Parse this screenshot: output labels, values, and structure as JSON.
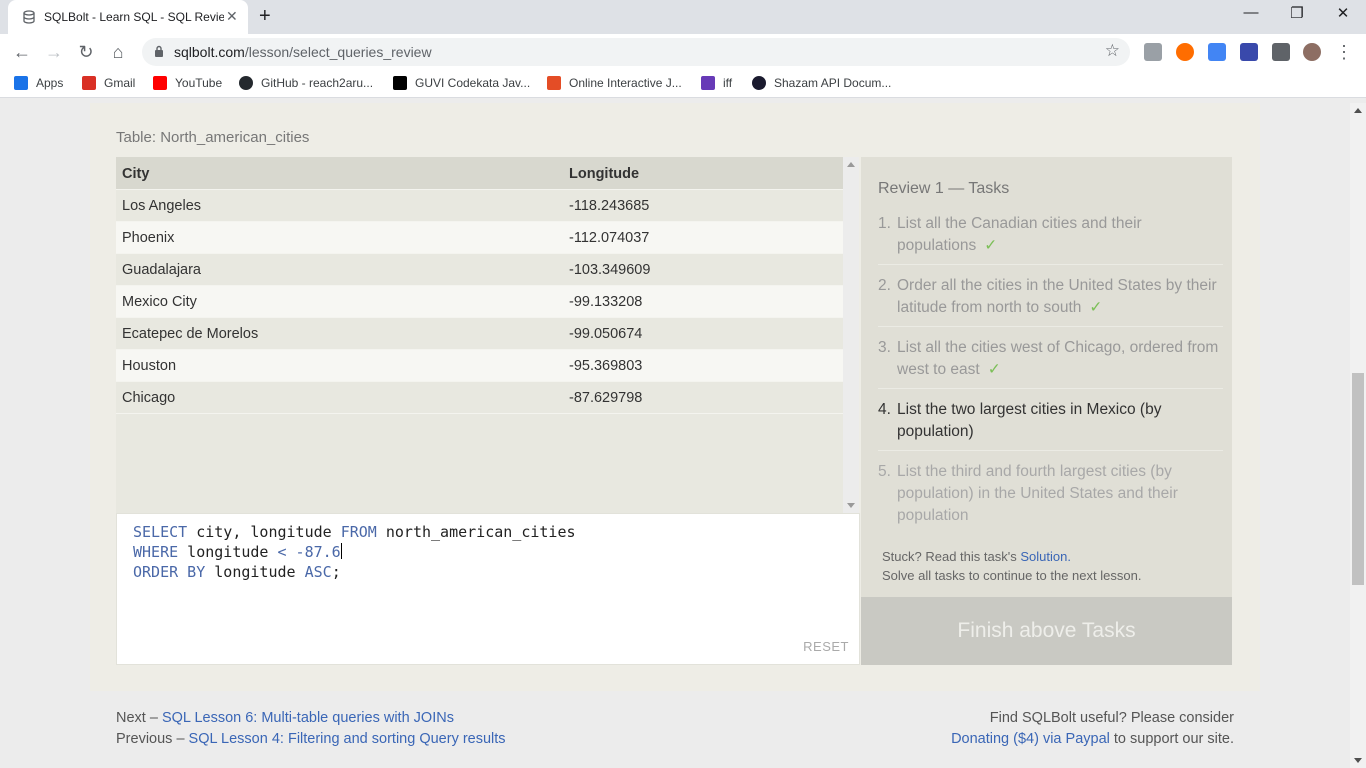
{
  "browser": {
    "tab_title": "SQLBolt - Learn SQL - SQL Review",
    "new_tab": "+",
    "url_host": "sqlbolt.com",
    "url_path": "/lesson/select_queries_review",
    "window_controls": {
      "minimize": "—",
      "restore": "❐",
      "close": "✕"
    },
    "nav": {
      "back": "←",
      "forward": "→",
      "reload": "↻",
      "home": "⌂"
    },
    "bookmarks": [
      {
        "label": "Apps",
        "icon": "apps-grid-icon",
        "color": "#1a73e8"
      },
      {
        "label": "Gmail",
        "icon": "gmail-icon",
        "color": "#d93025"
      },
      {
        "label": "YouTube",
        "icon": "youtube-icon",
        "color": "#ff0000"
      },
      {
        "label": "GitHub - reach2aru...",
        "icon": "github-icon",
        "color": "#24292e"
      },
      {
        "label": "GUVI Codekata Jav...",
        "icon": "medium-icon",
        "color": "#000000"
      },
      {
        "label": "Online Interactive J...",
        "icon": "html5-icon",
        "color": "#e44d26"
      },
      {
        "label": "iff",
        "icon": "list-icon",
        "color": "#673ab7"
      },
      {
        "label": "Shazam API Docum...",
        "icon": "shazam-icon",
        "color": "#1a1a2e"
      }
    ]
  },
  "page": {
    "table_caption": "Table: North_american_cities",
    "columns": [
      "City",
      "Longitude"
    ],
    "rows": [
      [
        "Los Angeles",
        "-118.243685"
      ],
      [
        "Phoenix",
        "-112.074037"
      ],
      [
        "Guadalajara",
        "-103.349609"
      ],
      [
        "Mexico City",
        "-99.133208"
      ],
      [
        "Ecatepec de Morelos",
        "-99.050674"
      ],
      [
        "Houston",
        "-95.369803"
      ],
      [
        "Chicago",
        "-87.629798"
      ]
    ],
    "query": {
      "line1_kw1": "SELECT",
      "line1_text1": " city, longitude ",
      "line1_kw2": "FROM",
      "line1_text2": " north_american_cities",
      "line2_kw1": "WHERE",
      "line2_text1": " longitude ",
      "line2_op": "<",
      "line2_num": " -87.6",
      "line3_kw1": "ORDER BY",
      "line3_text1": " longitude ",
      "line3_kw2": "ASC",
      "line3_end": ";"
    },
    "reset_label": "RESET",
    "tasks_title": "Review 1 — Tasks",
    "tasks": [
      {
        "num": "1.",
        "text": "List all the Canadian cities and their populations",
        "done": "✓"
      },
      {
        "num": "2.",
        "text": "Order all the cities in the United States by their latitude from north to south",
        "done": "✓"
      },
      {
        "num": "3.",
        "text": "List all the cities west of Chicago, ordered from west to east",
        "done": "✓"
      },
      {
        "num": "4.",
        "text": "List the two largest cities in Mexico (by population)"
      },
      {
        "num": "5.",
        "text": "List the third and fourth largest cities (by population) in the United States and their population"
      }
    ],
    "stuck_text": "Stuck? Read this task's ",
    "solution_link": "Solution",
    "stuck_end": ".",
    "solve_text": "Solve all tasks to continue to the next lesson.",
    "finish_label": "Finish above Tasks",
    "footer": {
      "next_prefix": "Next – ",
      "next_link": "SQL Lesson 6: Multi-table queries with JOINs",
      "prev_prefix": "Previous – ",
      "prev_link": "SQL Lesson 4: Filtering and sorting Query results",
      "useful_text": "Find SQLBolt useful? Please consider",
      "donate_link": "Donating ($4) via Paypal",
      "donate_suffix": " to support our site."
    }
  }
}
